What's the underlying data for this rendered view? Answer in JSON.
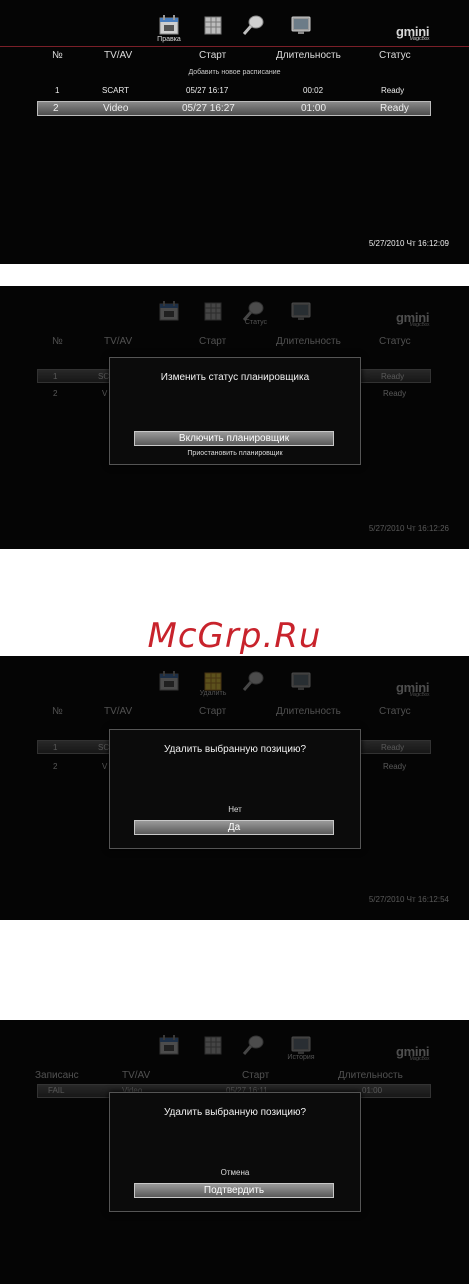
{
  "watermark": "McGrp.Ru",
  "logo": {
    "text": "gmini",
    "sub": "MagicBox"
  },
  "icons": [
    "calendar-icon",
    "grid-icon",
    "magnifier-icon",
    "monitor-icon"
  ],
  "screen1": {
    "icon_label": "Правка",
    "headers": [
      "№",
      "TV/AV",
      "Старт",
      "Длительность",
      "Статус"
    ],
    "add_new": "Добавить новое расписание",
    "rows": [
      {
        "num": "1",
        "src": "SCART",
        "start": "05/27 16:17",
        "dur": "00:02",
        "status": "Ready"
      },
      {
        "num": "2",
        "src": "Video",
        "start": "05/27 16:27",
        "dur": "01:00",
        "status": "Ready"
      }
    ],
    "clock": "5/27/2010 Чт 16:12:09"
  },
  "screen2": {
    "icon_label": "Статус",
    "headers": [
      "№",
      "TV/AV",
      "Старт",
      "Длительность",
      "Статус"
    ],
    "bg_rows": [
      {
        "num": "1",
        "src": "SC",
        "status": "Ready"
      },
      {
        "num": "2",
        "src": "V",
        "status": "Ready"
      }
    ],
    "dialog_title": "Изменить статус планировщика",
    "button": "Включить планировщик",
    "option": "Приостановить планировщик",
    "clock": "5/27/2010 Чт 16:12:26"
  },
  "screen3": {
    "icon_label": "Удалить",
    "headers": [
      "№",
      "TV/AV",
      "Старт",
      "Длительность",
      "Статус"
    ],
    "bg_rows": [
      {
        "num": "1",
        "src": "SC",
        "status": "Ready"
      },
      {
        "num": "2",
        "src": "V",
        "status": "Ready"
      }
    ],
    "dialog_title": "Удалить выбранную позицию?",
    "option": "Нет",
    "button": "Да",
    "clock": "5/27/2010 Чт 16:12:54"
  },
  "screen4": {
    "icon_label": "История",
    "headers": [
      "Записанс",
      "TV/AV",
      "Старт",
      "Длительность"
    ],
    "bg_row": {
      "status": "FAIL",
      "src": "Video",
      "start": "05/27 16:11",
      "dur": "01:00"
    },
    "dialog_title": "Удалить выбранную позицию?",
    "option": "Отмена",
    "button": "Подтвердить"
  }
}
